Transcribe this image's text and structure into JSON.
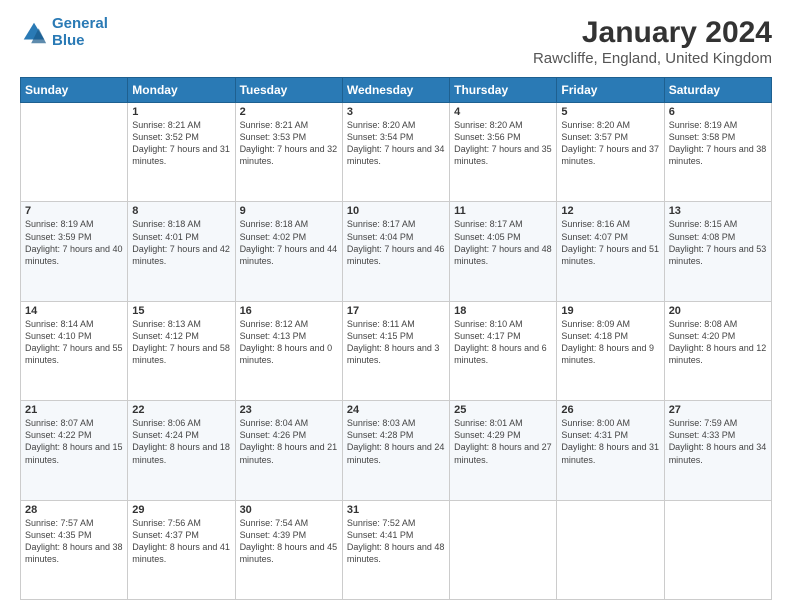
{
  "logo": {
    "line1": "General",
    "line2": "Blue"
  },
  "title": "January 2024",
  "subtitle": "Rawcliffe, England, United Kingdom",
  "days_of_week": [
    "Sunday",
    "Monday",
    "Tuesday",
    "Wednesday",
    "Thursday",
    "Friday",
    "Saturday"
  ],
  "weeks": [
    [
      {
        "day": "",
        "sunrise": "",
        "sunset": "",
        "daylight": ""
      },
      {
        "day": "1",
        "sunrise": "Sunrise: 8:21 AM",
        "sunset": "Sunset: 3:52 PM",
        "daylight": "Daylight: 7 hours and 31 minutes."
      },
      {
        "day": "2",
        "sunrise": "Sunrise: 8:21 AM",
        "sunset": "Sunset: 3:53 PM",
        "daylight": "Daylight: 7 hours and 32 minutes."
      },
      {
        "day": "3",
        "sunrise": "Sunrise: 8:20 AM",
        "sunset": "Sunset: 3:54 PM",
        "daylight": "Daylight: 7 hours and 34 minutes."
      },
      {
        "day": "4",
        "sunrise": "Sunrise: 8:20 AM",
        "sunset": "Sunset: 3:56 PM",
        "daylight": "Daylight: 7 hours and 35 minutes."
      },
      {
        "day": "5",
        "sunrise": "Sunrise: 8:20 AM",
        "sunset": "Sunset: 3:57 PM",
        "daylight": "Daylight: 7 hours and 37 minutes."
      },
      {
        "day": "6",
        "sunrise": "Sunrise: 8:19 AM",
        "sunset": "Sunset: 3:58 PM",
        "daylight": "Daylight: 7 hours and 38 minutes."
      }
    ],
    [
      {
        "day": "7",
        "sunrise": "Sunrise: 8:19 AM",
        "sunset": "Sunset: 3:59 PM",
        "daylight": "Daylight: 7 hours and 40 minutes."
      },
      {
        "day": "8",
        "sunrise": "Sunrise: 8:18 AM",
        "sunset": "Sunset: 4:01 PM",
        "daylight": "Daylight: 7 hours and 42 minutes."
      },
      {
        "day": "9",
        "sunrise": "Sunrise: 8:18 AM",
        "sunset": "Sunset: 4:02 PM",
        "daylight": "Daylight: 7 hours and 44 minutes."
      },
      {
        "day": "10",
        "sunrise": "Sunrise: 8:17 AM",
        "sunset": "Sunset: 4:04 PM",
        "daylight": "Daylight: 7 hours and 46 minutes."
      },
      {
        "day": "11",
        "sunrise": "Sunrise: 8:17 AM",
        "sunset": "Sunset: 4:05 PM",
        "daylight": "Daylight: 7 hours and 48 minutes."
      },
      {
        "day": "12",
        "sunrise": "Sunrise: 8:16 AM",
        "sunset": "Sunset: 4:07 PM",
        "daylight": "Daylight: 7 hours and 51 minutes."
      },
      {
        "day": "13",
        "sunrise": "Sunrise: 8:15 AM",
        "sunset": "Sunset: 4:08 PM",
        "daylight": "Daylight: 7 hours and 53 minutes."
      }
    ],
    [
      {
        "day": "14",
        "sunrise": "Sunrise: 8:14 AM",
        "sunset": "Sunset: 4:10 PM",
        "daylight": "Daylight: 7 hours and 55 minutes."
      },
      {
        "day": "15",
        "sunrise": "Sunrise: 8:13 AM",
        "sunset": "Sunset: 4:12 PM",
        "daylight": "Daylight: 7 hours and 58 minutes."
      },
      {
        "day": "16",
        "sunrise": "Sunrise: 8:12 AM",
        "sunset": "Sunset: 4:13 PM",
        "daylight": "Daylight: 8 hours and 0 minutes."
      },
      {
        "day": "17",
        "sunrise": "Sunrise: 8:11 AM",
        "sunset": "Sunset: 4:15 PM",
        "daylight": "Daylight: 8 hours and 3 minutes."
      },
      {
        "day": "18",
        "sunrise": "Sunrise: 8:10 AM",
        "sunset": "Sunset: 4:17 PM",
        "daylight": "Daylight: 8 hours and 6 minutes."
      },
      {
        "day": "19",
        "sunrise": "Sunrise: 8:09 AM",
        "sunset": "Sunset: 4:18 PM",
        "daylight": "Daylight: 8 hours and 9 minutes."
      },
      {
        "day": "20",
        "sunrise": "Sunrise: 8:08 AM",
        "sunset": "Sunset: 4:20 PM",
        "daylight": "Daylight: 8 hours and 12 minutes."
      }
    ],
    [
      {
        "day": "21",
        "sunrise": "Sunrise: 8:07 AM",
        "sunset": "Sunset: 4:22 PM",
        "daylight": "Daylight: 8 hours and 15 minutes."
      },
      {
        "day": "22",
        "sunrise": "Sunrise: 8:06 AM",
        "sunset": "Sunset: 4:24 PM",
        "daylight": "Daylight: 8 hours and 18 minutes."
      },
      {
        "day": "23",
        "sunrise": "Sunrise: 8:04 AM",
        "sunset": "Sunset: 4:26 PM",
        "daylight": "Daylight: 8 hours and 21 minutes."
      },
      {
        "day": "24",
        "sunrise": "Sunrise: 8:03 AM",
        "sunset": "Sunset: 4:28 PM",
        "daylight": "Daylight: 8 hours and 24 minutes."
      },
      {
        "day": "25",
        "sunrise": "Sunrise: 8:01 AM",
        "sunset": "Sunset: 4:29 PM",
        "daylight": "Daylight: 8 hours and 27 minutes."
      },
      {
        "day": "26",
        "sunrise": "Sunrise: 8:00 AM",
        "sunset": "Sunset: 4:31 PM",
        "daylight": "Daylight: 8 hours and 31 minutes."
      },
      {
        "day": "27",
        "sunrise": "Sunrise: 7:59 AM",
        "sunset": "Sunset: 4:33 PM",
        "daylight": "Daylight: 8 hours and 34 minutes."
      }
    ],
    [
      {
        "day": "28",
        "sunrise": "Sunrise: 7:57 AM",
        "sunset": "Sunset: 4:35 PM",
        "daylight": "Daylight: 8 hours and 38 minutes."
      },
      {
        "day": "29",
        "sunrise": "Sunrise: 7:56 AM",
        "sunset": "Sunset: 4:37 PM",
        "daylight": "Daylight: 8 hours and 41 minutes."
      },
      {
        "day": "30",
        "sunrise": "Sunrise: 7:54 AM",
        "sunset": "Sunset: 4:39 PM",
        "daylight": "Daylight: 8 hours and 45 minutes."
      },
      {
        "day": "31",
        "sunrise": "Sunrise: 7:52 AM",
        "sunset": "Sunset: 4:41 PM",
        "daylight": "Daylight: 8 hours and 48 minutes."
      },
      {
        "day": "",
        "sunrise": "",
        "sunset": "",
        "daylight": ""
      },
      {
        "day": "",
        "sunrise": "",
        "sunset": "",
        "daylight": ""
      },
      {
        "day": "",
        "sunrise": "",
        "sunset": "",
        "daylight": ""
      }
    ]
  ]
}
